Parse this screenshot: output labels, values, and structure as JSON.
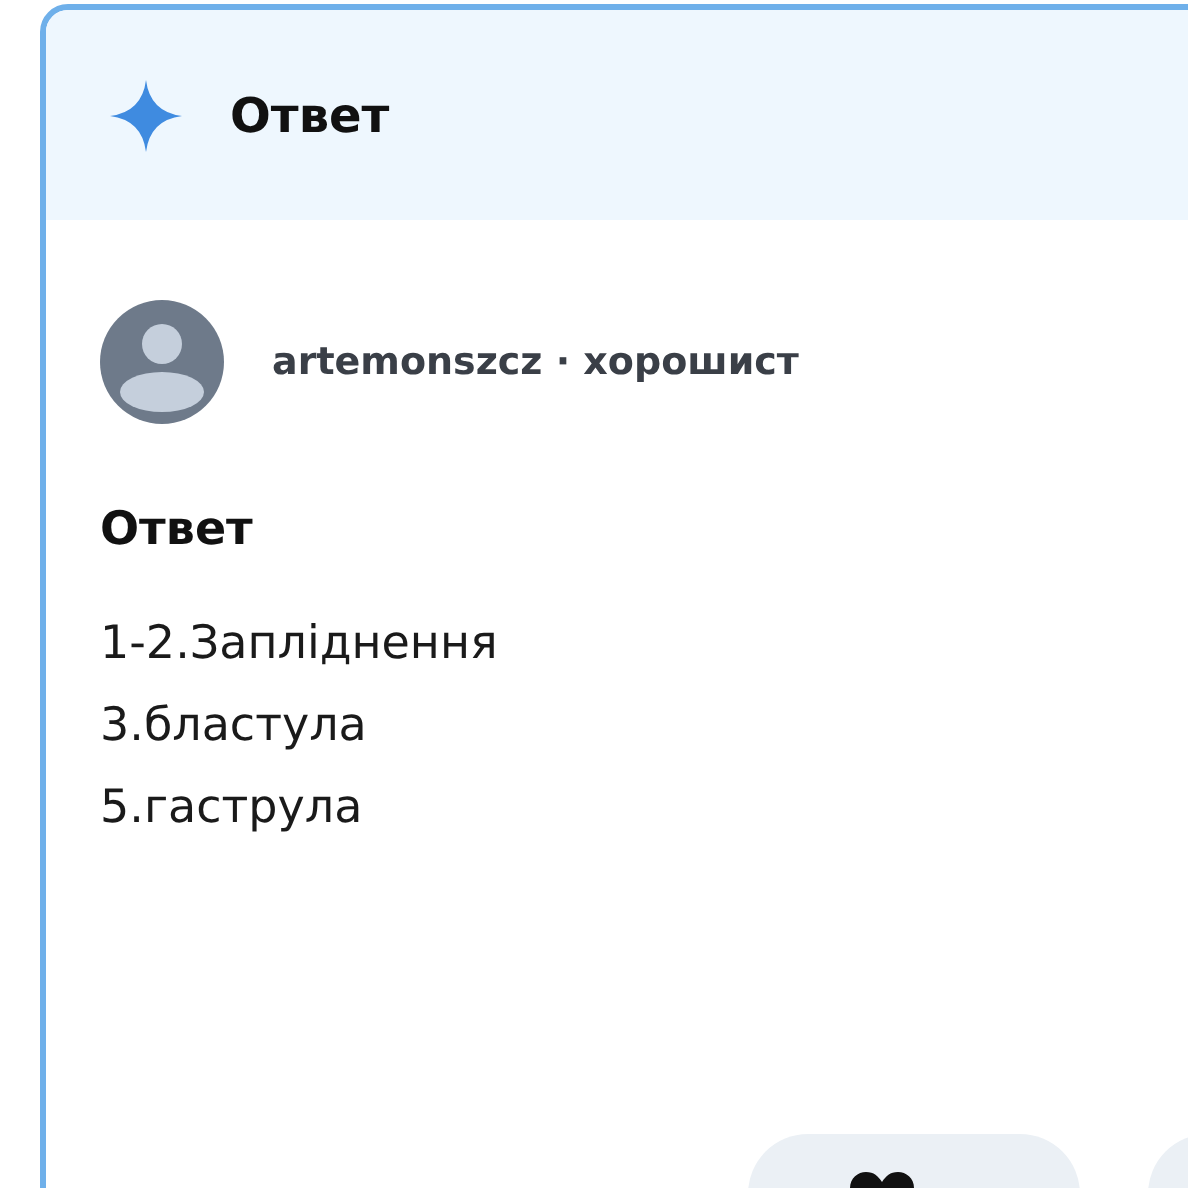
{
  "header": {
    "title": "Ответ"
  },
  "author": {
    "name": "artemonszcz",
    "separator": "·",
    "rank": "хорошист"
  },
  "answer": {
    "heading": "Ответ",
    "lines": [
      "1-2.Запліднення",
      "3.бластула",
      "5.гаструла"
    ]
  }
}
